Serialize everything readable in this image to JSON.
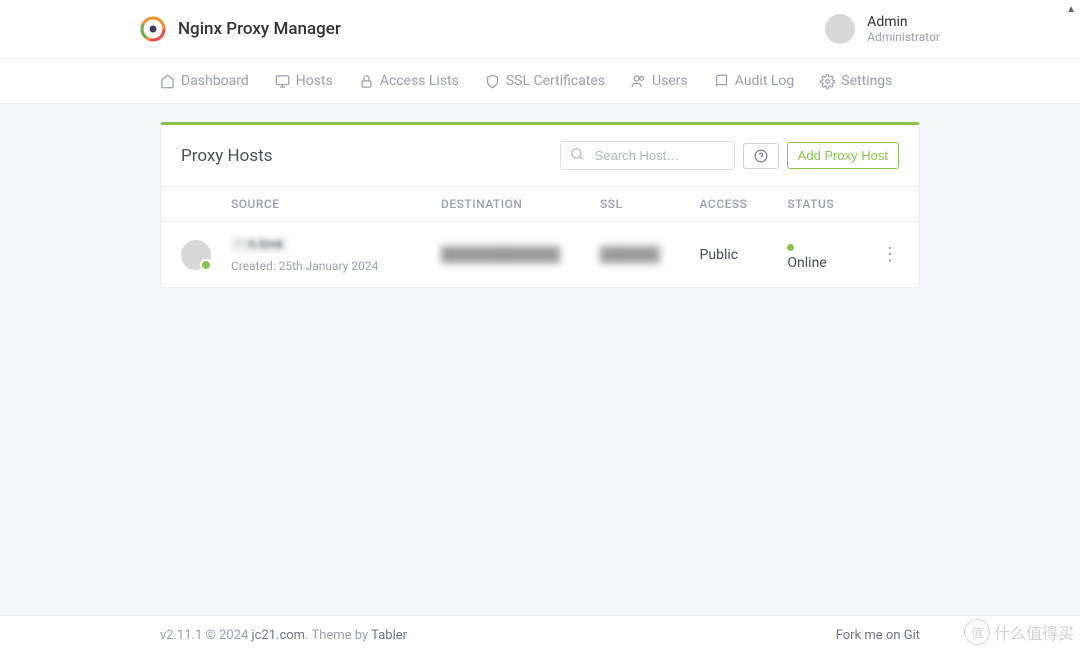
{
  "header": {
    "app_title": "Nginx Proxy Manager",
    "user_name": "Admin",
    "user_role": "Administrator"
  },
  "nav": {
    "dashboard": "Dashboard",
    "hosts": "Hosts",
    "access_lists": "Access Lists",
    "ssl": "SSL Certificates",
    "users": "Users",
    "audit": "Audit Log",
    "settings": "Settings"
  },
  "page": {
    "title": "Proxy Hosts",
    "search_placeholder": "Search Host…",
    "add_button": "Add Proxy Host"
  },
  "table": {
    "headers": {
      "source": "SOURCE",
      "destination": "DESTINATION",
      "ssl": "SSL",
      "access": "ACCESS",
      "status": "STATUS"
    },
    "rows": [
      {
        "domain": "····n.love",
        "created": "Created: 25th January 2024",
        "destination": "████████████",
        "ssl": "██████",
        "access": "Public",
        "status": "Online"
      }
    ]
  },
  "footer": {
    "version": "v2.11.1 © 2024 ",
    "link1": "jc21.com",
    "theme": ". Theme by ",
    "link2": "Tabler",
    "fork": "Fork me on Git"
  },
  "watermark": {
    "circle": "值",
    "text": "什么值得买"
  }
}
